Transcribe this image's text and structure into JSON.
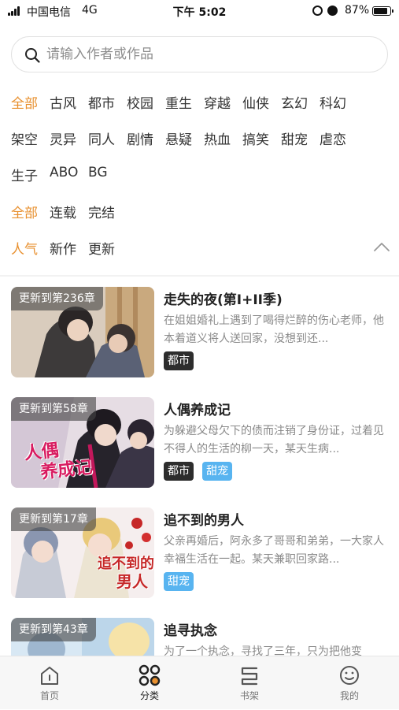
{
  "status_bar": {
    "carrier": "中国电信",
    "network": "4G",
    "time": "下午 5:02",
    "battery": "87%",
    "battery_level": 0.87
  },
  "search": {
    "placeholder": "请输入作者或作品"
  },
  "filters": {
    "genres": [
      "全部",
      "古风",
      "都市",
      "校园",
      "重生",
      "穿越",
      "仙侠",
      "玄幻",
      "科幻",
      "架空",
      "灵异",
      "同人",
      "剧情",
      "悬疑",
      "热血",
      "搞笑",
      "甜宠",
      "虐恋",
      "生子",
      "ABO",
      "BG"
    ],
    "status": [
      "全部",
      "连载",
      "完结"
    ],
    "sort": [
      "人气",
      "新作",
      "更新"
    ],
    "active_color": "#e8902f"
  },
  "comics": [
    {
      "title": "走失的夜(第I+II季)",
      "update": "更新到第236章",
      "desc": "在姐姐婚礼上遇到了喝得烂醉的伤心老师，他本着道义将人送回家，没想到还...",
      "tags": [
        {
          "label": "都市",
          "style": "dark"
        }
      ]
    },
    {
      "title": "人偶养成记",
      "update": "更新到第58章",
      "desc": "为躲避父母欠下的债而注销了身份证，过着见不得人的生活的柳一天，某天生病...",
      "cover_text": [
        "人偶",
        "养成记"
      ],
      "tags": [
        {
          "label": "都市",
          "style": "dark"
        },
        {
          "label": "甜宠",
          "style": "blue"
        }
      ]
    },
    {
      "title": "追不到的男人",
      "update": "更新到第17章",
      "desc": "父亲再婚后，阿永多了哥哥和弟弟，一大家人幸福生活在一起。某天兼职回家路...",
      "cover_text": [
        "追不到的",
        "男人"
      ],
      "tags": [
        {
          "label": "甜宠",
          "style": "blue"
        }
      ]
    },
    {
      "title": "追寻执念",
      "update": "更新到第43章",
      "desc": "为了一个执念，寻找了三年，只为把他变",
      "tags": []
    }
  ],
  "tabbar": [
    {
      "label": "首页",
      "icon": "home-icon"
    },
    {
      "label": "分类",
      "icon": "category-icon",
      "active": true
    },
    {
      "label": "书架",
      "icon": "bookshelf-icon"
    },
    {
      "label": "我的",
      "icon": "profile-icon"
    }
  ]
}
